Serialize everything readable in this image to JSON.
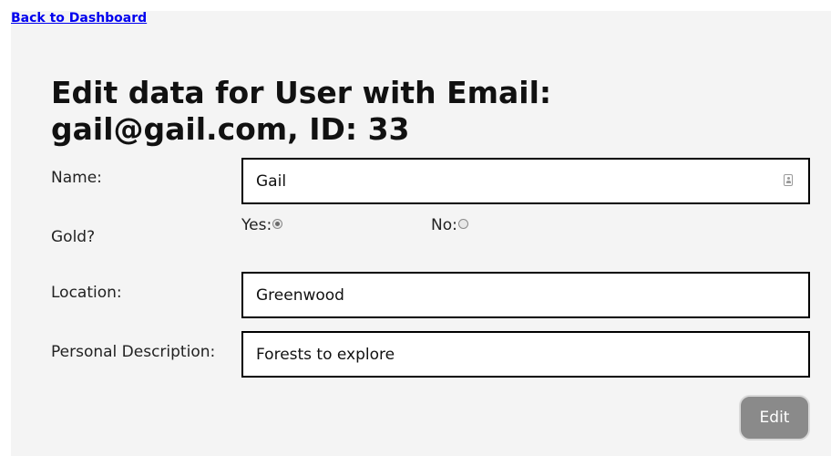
{
  "nav": {
    "back_link": "Back to Dashboard"
  },
  "form": {
    "title": "Edit data for User with Email: gail@gail.com, ID: 33",
    "name": {
      "label": "Name:",
      "value": "Gail"
    },
    "gold": {
      "label": "Gold?",
      "yes_label": "Yes:",
      "no_label": "No:",
      "selected": "Yes"
    },
    "location": {
      "label": "Location:",
      "value": "Greenwood"
    },
    "description": {
      "label": "Personal Description:",
      "value": "Forests to explore"
    },
    "submit_label": "Edit"
  },
  "colors": {
    "panel_background": "#f4f4f4",
    "link": "#0000ee",
    "button_background": "#8a8a8a",
    "input_border": "#000000"
  },
  "icons": {
    "name_field_icon": "contact-card-icon"
  }
}
